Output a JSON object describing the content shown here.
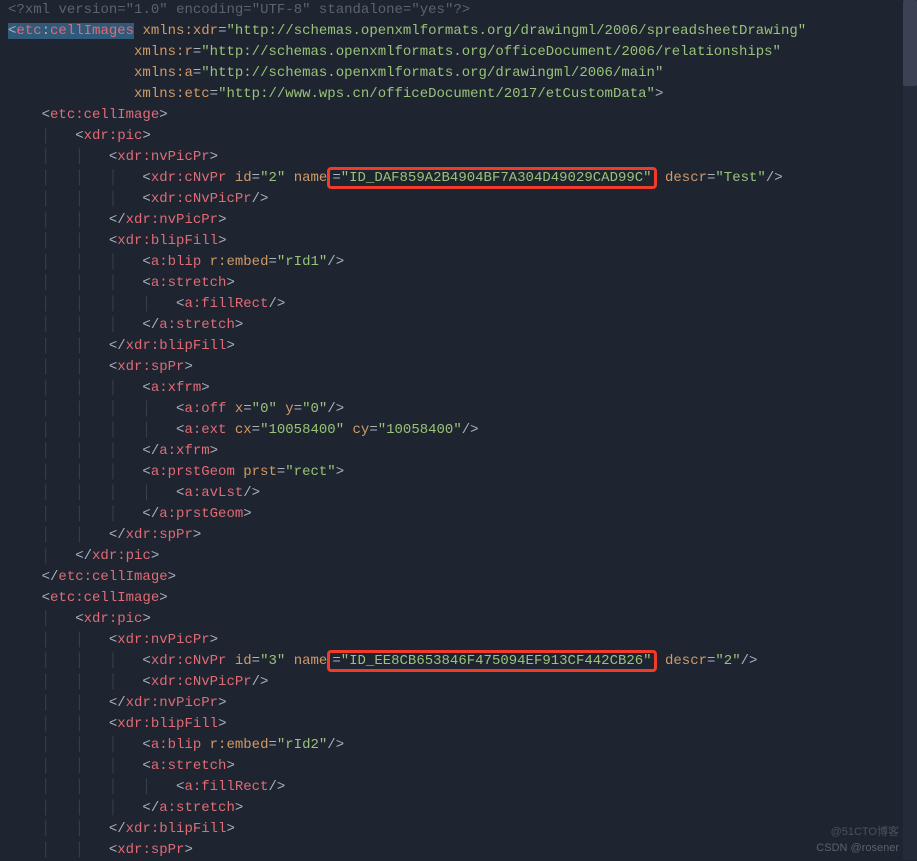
{
  "xml_decl": {
    "prefix": "<?",
    "tag": "xml",
    "attrs": [
      {
        "k": "version",
        "v": "\"1.0\""
      },
      {
        "k": "encoding",
        "v": "\"UTF-8\""
      },
      {
        "k": "standalone",
        "v": "\"yes\""
      }
    ],
    "suffix": "?>"
  },
  "root": {
    "open": "<",
    "ns": "etc",
    "col": ":",
    "tag": "cellImages",
    "close": ">",
    "ns_decls": [
      {
        "k": "xmlns:",
        "ns": "xdr",
        "v": "\"http://schemas.openxmlformats.org/drawingml/2006/spreadsheetDrawing\""
      },
      {
        "k": "xmlns:",
        "ns": "r",
        "v": "\"http://schemas.openxmlformats.org/officeDocument/2006/relationships\""
      },
      {
        "k": "xmlns:",
        "ns": "a",
        "v": "\"http://schemas.openxmlformats.org/drawingml/2006/main\""
      },
      {
        "k": "xmlns:",
        "ns": "etc",
        "v": "\"http://www.wps.cn/officeDocument/2017/etCustomData\""
      }
    ]
  },
  "block1": {
    "cellImgOpen": "etc:cellImage",
    "pic": "xdr:pic",
    "nvPicPr": "xdr:nvPicPr",
    "cNvPr": {
      "tag": "xdr:cNvPr",
      "id": "\"2\"",
      "nameAttr": "name",
      "name": "\"ID_DAF859A2B4904BF7A304D49029CAD99C\"",
      "descrAttr": "descr",
      "descr": "\"Test\""
    },
    "cNvPicPr": "xdr:cNvPicPr",
    "blipFill": "xdr:blipFill",
    "blip": {
      "tag": "a:blip",
      "rembed": "r:embed",
      "v": "\"rId1\""
    },
    "stretch": "a:stretch",
    "fillRect": "a:fillRect",
    "spPr": "xdr:spPr",
    "xfrm": "a:xfrm",
    "off": {
      "tag": "a:off",
      "x": "\"0\"",
      "y": "\"0\""
    },
    "ext": {
      "tag": "a:ext",
      "cx": "\"10058400\"",
      "cy": "\"10058400\""
    },
    "prstGeom": {
      "tag": "a:prstGeom",
      "prstAttr": "prst",
      "v": "\"rect\""
    },
    "avLst": "a:avLst"
  },
  "block2": {
    "cellImgOpen": "etc:cellImage",
    "pic": "xdr:pic",
    "nvPicPr": "xdr:nvPicPr",
    "cNvPr": {
      "tag": "xdr:cNvPr",
      "id": "\"3\"",
      "nameAttr": "name",
      "name": "\"ID_EE8CB653846F475094EF913CF442CB26\"",
      "descrAttr": "descr",
      "descr": "\"2\""
    },
    "cNvPicPr": "xdr:cNvPicPr",
    "blipFill": "xdr:blipFill",
    "blip": {
      "tag": "a:blip",
      "rembed": "r:embed",
      "v": "\"rId2\""
    },
    "stretch": "a:stretch",
    "fillRect": "a:fillRect",
    "spPr": "xdr:spPr"
  },
  "watermark": {
    "line1": "@51CTO博客",
    "line2": "CSDN @rosener"
  }
}
